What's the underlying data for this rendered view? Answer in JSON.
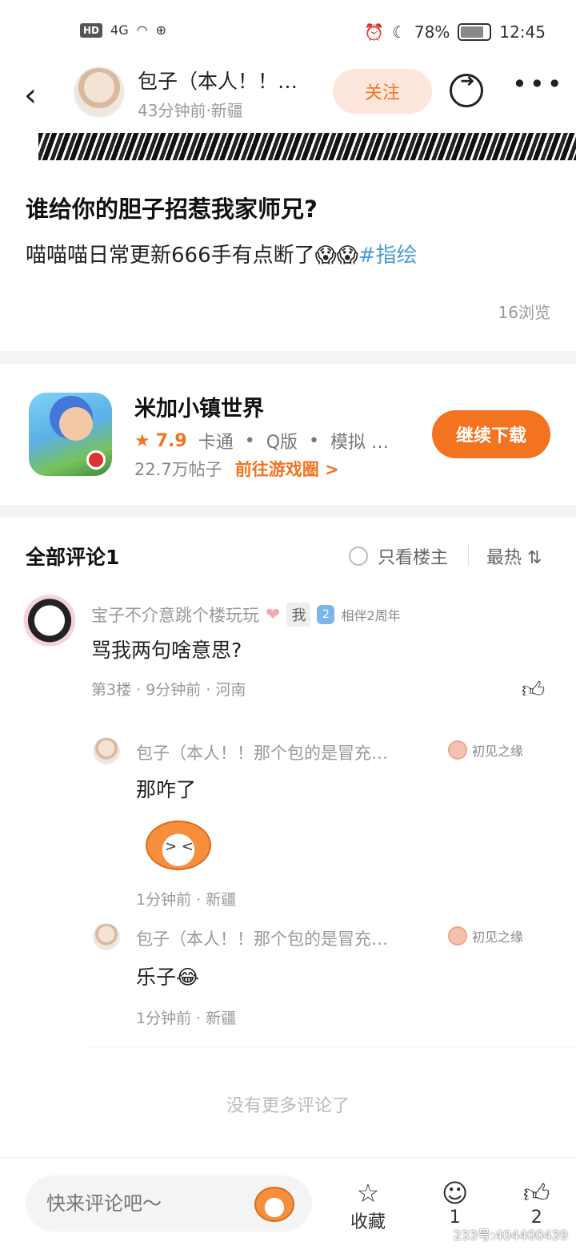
{
  "status_bar": {
    "network": "HD",
    "signal": "4G",
    "battery": "78%",
    "time": "12:45"
  },
  "header": {
    "back_icon": "back-arrow-icon",
    "user_name": "包子（本人！！…",
    "meta": "43分钟前·新疆",
    "follow_label": "关注",
    "share_icon": "share-icon",
    "more_icon": "more-dots-icon"
  },
  "post": {
    "title": "谁给你的胆子招惹我家师兄?",
    "body": "喵喵喵日常更新666手有点断了😱😱",
    "tag": "#指绘",
    "views": "16浏览"
  },
  "game": {
    "name": "米加小镇世界",
    "rating": "7.9",
    "tags": [
      "卡通",
      "Q版",
      "模拟 …"
    ],
    "posts": "22.7万帖子",
    "link": "前往游戏圈 >",
    "download_label": "继续下载"
  },
  "comments_section": {
    "title": "全部评论1",
    "only_op": "只看楼主",
    "sort": "最热 ⇅",
    "no_more": "没有更多评论了"
  },
  "comment": {
    "user": "宝子不介意跳个楼玩玩",
    "me_badge": "我",
    "level": "2",
    "level_text": "相伴2周年",
    "text": "骂我两句啥意思?",
    "meta": "第3楼 · 9分钟前 · 河南"
  },
  "replies": [
    {
      "user": "包子（本人！！那个包的是冒充…",
      "badge": "初见之缘",
      "text": "那咋了",
      "meta": "1分钟前 · 新疆"
    },
    {
      "user": "包子（本人！！那个包的是冒充…",
      "badge": "初见之缘",
      "text": "乐子😂",
      "meta": "1分钟前 · 新疆"
    }
  ],
  "bottom_bar": {
    "input_placeholder": "快来评论吧～",
    "favorite_label": "收藏",
    "comment_count": "1",
    "like_count": "2",
    "watermark": "233号:404400439"
  }
}
